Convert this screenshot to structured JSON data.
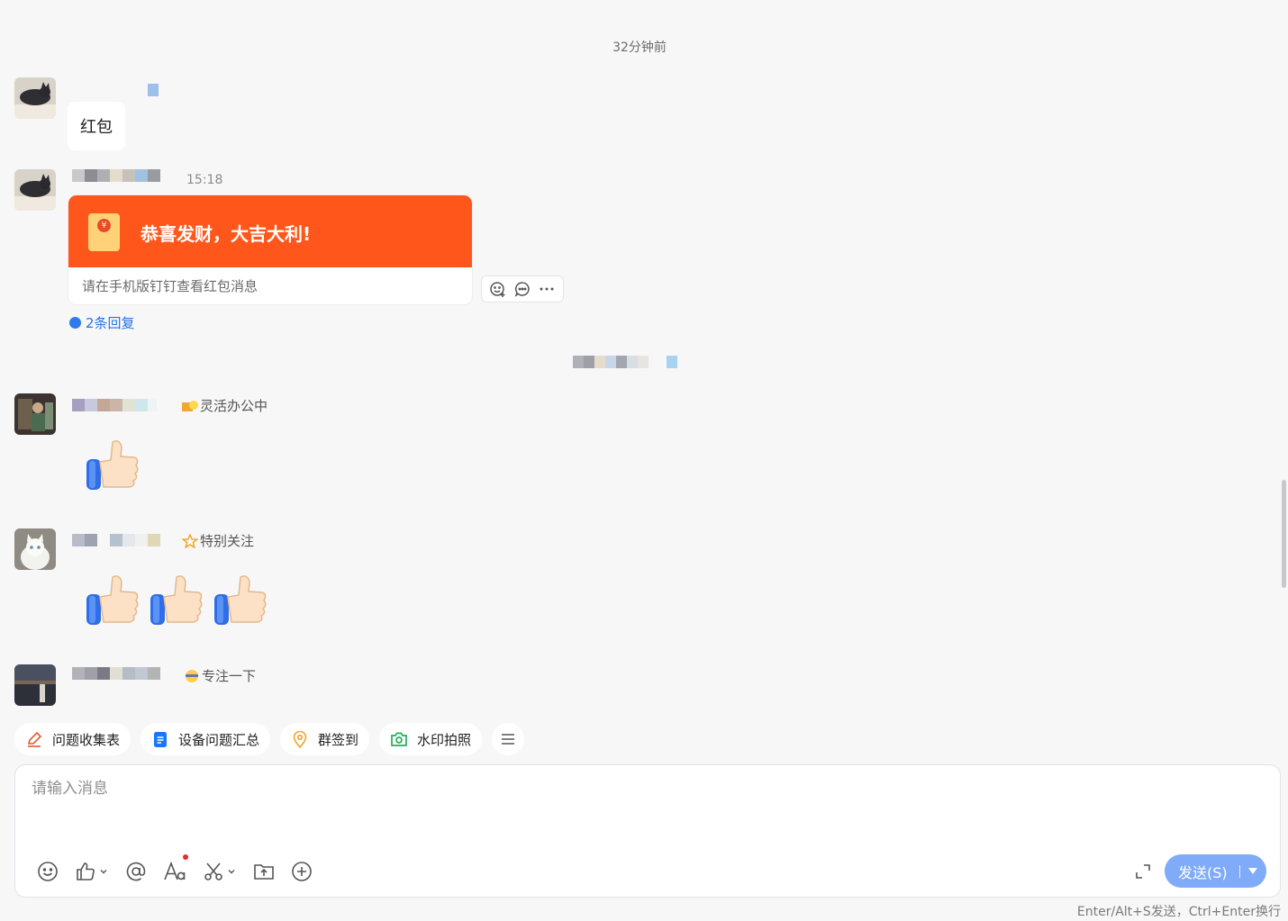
{
  "chat": {
    "time_divider": "32分钟前",
    "messages": [
      {
        "type": "text",
        "text": "红包"
      },
      {
        "type": "red_packet",
        "time": "15:18",
        "title": "恭喜发财，大吉大利!",
        "coin_symbol": "¥",
        "note": "请在手机版钉钉查看红包消息",
        "replies": "2条回复",
        "actions": [
          "emoji-reply",
          "comment",
          "more"
        ]
      },
      {
        "type": "sticker",
        "status": "灵活办公中",
        "stickers": [
          "thumbs-up"
        ]
      },
      {
        "type": "sticker",
        "status": "特别关注",
        "stickers": [
          "thumbs-up",
          "thumbs-up",
          "thumbs-up"
        ]
      },
      {
        "type": "partial",
        "status": "专注一下"
      }
    ]
  },
  "quick_actions": [
    {
      "label": "问题收集表",
      "icon": "pencil-icon",
      "color": "#e8572a"
    },
    {
      "label": "设备问题汇总",
      "icon": "doc-icon",
      "color": "#1677ff"
    },
    {
      "label": "群签到",
      "icon": "location-pin-icon",
      "color": "#f2a22b"
    },
    {
      "label": "水印拍照",
      "icon": "camera-icon",
      "color": "#1fae5b"
    }
  ],
  "composer": {
    "placeholder": "请输入消息",
    "send_label": "发送(S)",
    "hint": "Enter/Alt+S发送，Ctrl+Enter换行"
  },
  "colors": {
    "red_packet": "#ff571b",
    "link": "#2473e6",
    "send": "#7fabf8"
  }
}
